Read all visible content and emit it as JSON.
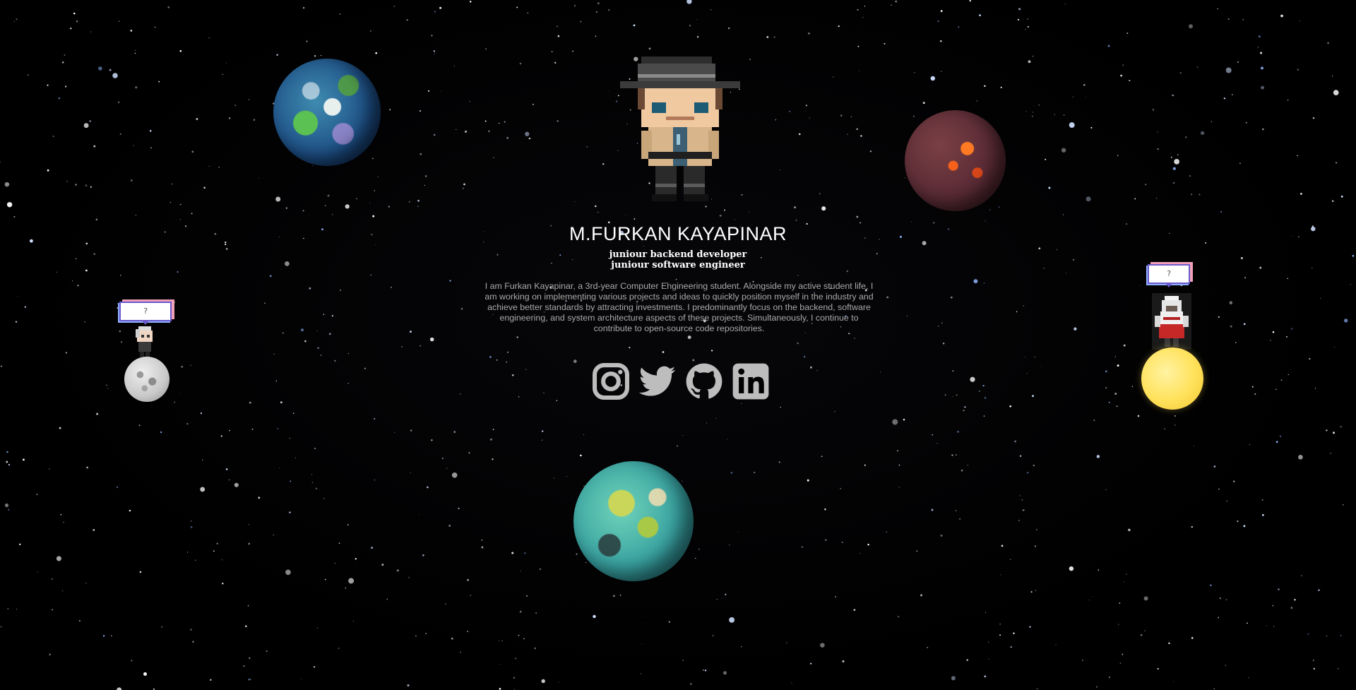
{
  "profile": {
    "name": "M.FURKAN KAYAPINAR",
    "roles": [
      "juniour backend developer",
      "juniour software engineer"
    ],
    "bio": "I am Furkan Kayapinar, a 3rd-year Computer Engineering student. Alongside my active student life, I am working on implementing various projects and ideas to quickly position myself in the industry and achieve better standards by attracting investments. I predominantly focus on the backend, software engineering, and system architecture aspects of these projects. Simultaneously, I continue to contribute to open-source code repositories."
  },
  "socials": [
    {
      "icon": "instagram-icon"
    },
    {
      "icon": "twitter-icon"
    },
    {
      "icon": "github-icon"
    },
    {
      "icon": "linkedin-icon"
    }
  ],
  "bubbles": {
    "left": "?",
    "right": "?"
  },
  "colors": {
    "background": "#000000",
    "name_text": "#ffffff",
    "bio_text": "#a9a9a9",
    "social_icon": "#bdbdbd"
  }
}
